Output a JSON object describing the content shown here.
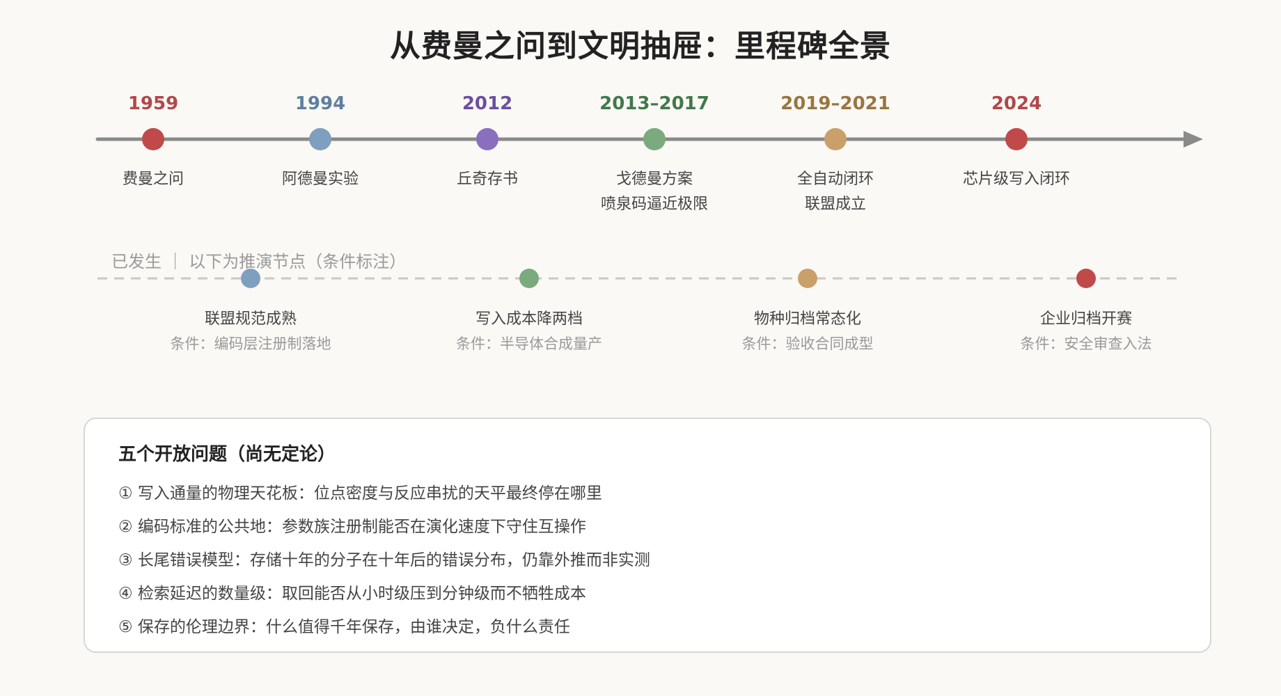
{
  "title": "从费曼之问到文明抽屉：里程碑全景",
  "colors": {
    "axis": "#8a8a8a",
    "dashed": "#c8c8c8",
    "red": "#c0494a",
    "blue": "#7f9fbf",
    "purple": "#8a6fbf",
    "green": "#7aaa7e",
    "tan": "#c9a06a",
    "year_green": "#3f7a4a",
    "year_tan": "#9a7540",
    "year_blue": "#5f7fa0",
    "year_purple": "#6b4fa0",
    "year_red": "#b0484a"
  },
  "milestones": [
    {
      "year": "1959",
      "lines": [
        "费曼之问"
      ],
      "dot": "#c0494a",
      "year_color": "#b0484a"
    },
    {
      "year": "1994",
      "lines": [
        "阿德曼实验"
      ],
      "dot": "#7f9fbf",
      "year_color": "#5f7fa0"
    },
    {
      "year": "2012",
      "lines": [
        "丘奇存书"
      ],
      "dot": "#8a6fbf",
      "year_color": "#6b4fa0"
    },
    {
      "year": "2013–2017",
      "lines": [
        "戈德曼方案",
        "喷泉码逼近极限"
      ],
      "dot": "#7aaa7e",
      "year_color": "#3f7a4a"
    },
    {
      "year": "2019–2021",
      "lines": [
        "全自动闭环",
        "联盟成立"
      ],
      "dot": "#c9a06a",
      "year_color": "#9a7540"
    },
    {
      "year": "2024",
      "lines": [
        "芯片级写入闭环"
      ],
      "dot": "#c0494a",
      "year_color": "#b0484a"
    }
  ],
  "divider_label": "已发生 ｜ 以下为推演节点（条件标注）",
  "projections": [
    {
      "title": "联盟规范成熟",
      "condition": "条件：编码层注册制落地",
      "dot": "#7f9fbf"
    },
    {
      "title": "写入成本降两档",
      "condition": "条件：半导体合成量产",
      "dot": "#7aaa7e"
    },
    {
      "title": "物种归档常态化",
      "condition": "条件：验收合同成型",
      "dot": "#c9a06a"
    },
    {
      "title": "企业归档开赛",
      "condition": "条件：安全审查入法",
      "dot": "#c0494a"
    }
  ],
  "questions": {
    "title": "五个开放问题（尚无定论）",
    "items": [
      "① 写入通量的物理天花板：位点密度与反应串扰的天平最终停在哪里",
      "② 编码标准的公共地：参数族注册制能否在演化速度下守住互操作",
      "③ 长尾错误模型：存储十年的分子在十年后的错误分布，仍靠外推而非实测",
      "④ 检索延迟的数量级：取回能否从小时级压到分钟级而不牺牲成本",
      "⑤ 保存的伦理边界：什么值得千年保存，由谁决定，负什么责任"
    ]
  }
}
